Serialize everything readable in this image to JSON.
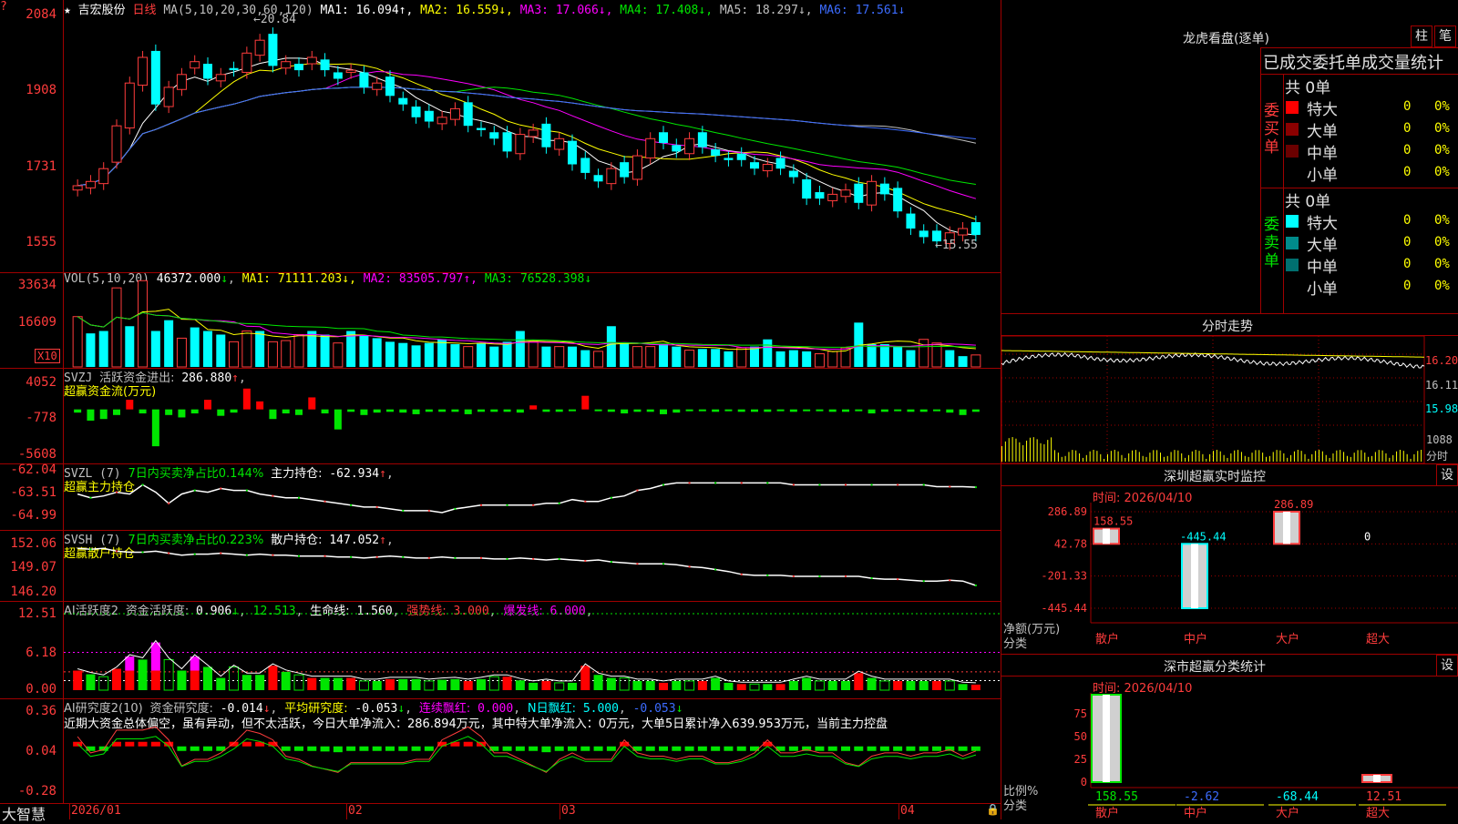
{
  "stock": {
    "name": "吉宏股份",
    "period": "日线",
    "star": "★",
    "leftmark": "?"
  },
  "kline": {
    "ma_label": "MA(5,10,20,30,60,120)",
    "ma": [
      {
        "label": "MA1:",
        "value": "16.094",
        "arrow": "↑",
        "color": "#ffffff"
      },
      {
        "label": "MA2:",
        "value": "16.559",
        "arrow": "↓",
        "color": "#ffff00"
      },
      {
        "label": "MA3:",
        "value": "17.066",
        "arrow": "↓",
        "color": "#ff00ff"
      },
      {
        "label": "MA4:",
        "value": "17.408",
        "arrow": "↓",
        "color": "#00e600"
      },
      {
        "label": "MA5:",
        "value": "18.297",
        "arrow": "↓",
        "color": "#c0c0c0"
      },
      {
        "label": "MA6:",
        "value": "17.561",
        "arrow": "↓",
        "color": "#3c6cff"
      }
    ],
    "yticks": [
      "2084",
      "1908",
      "1731",
      "1555"
    ],
    "high_note": "←20.84",
    "low_note": "←15.55"
  },
  "vol": {
    "title": "VOL(5,10,20)",
    "value": "46372.000",
    "ma": [
      {
        "label": "MA1:",
        "value": "71111.203",
        "arrow": "↓",
        "color": "#ffff00"
      },
      {
        "label": "MA2:",
        "value": "83505.797",
        "arrow": "↑",
        "color": "#ff00ff"
      },
      {
        "label": "MA3:",
        "value": "76528.398",
        "arrow": "↓",
        "color": "#00e600"
      }
    ],
    "yticks": [
      "33634",
      "16609"
    ],
    "unit": "X10"
  },
  "svzj": {
    "title": "SVZJ",
    "label": "活跃资金进出:",
    "value": "286.880",
    "arrow": "↑",
    "subtitle": "超赢资金流(万元)",
    "yticks": [
      "4052",
      "-778",
      "-5608"
    ]
  },
  "svzl": {
    "title": "SVZL (7)",
    "text1": "7日内买卖净占比0.144%",
    "text2": "主力持仓:",
    "value": "-62.934",
    "arrow": "↑",
    "subtitle": "超赢主力持仓",
    "yticks": [
      "-62.04",
      "-63.51",
      "-64.99"
    ]
  },
  "svsh": {
    "title": "SVSH (7)",
    "text1": "7日内买卖净占比0.223%",
    "text2": "散户持仓:",
    "value": "147.052",
    "arrow": "↑",
    "subtitle": "超赢散户持仓",
    "yticks": [
      "152.06",
      "149.07",
      "146.20"
    ]
  },
  "ai1": {
    "title": "AI活跃度2",
    "l1": "资金活跃度:",
    "v1": "0.906",
    "a1": "↓",
    "v2": "12.513",
    "l3": "生命线:",
    "v3": "1.560",
    "l4": "强势线:",
    "v4": "3.000",
    "l5": "爆发线:",
    "v5": "6.000",
    "yticks": [
      "12.51",
      "6.18",
      "0.00"
    ]
  },
  "ai2": {
    "title": "AI研究度2(10)",
    "l1": "资金研究度:",
    "v1": "-0.014",
    "a1": "↓",
    "l2": "平均研究度:",
    "v2": "-0.053",
    "a2": "↓",
    "l3": "连续飘红:",
    "v3": "0.000",
    "l4": "N日飘红:",
    "v4": "5.000",
    "v5": "-0.053",
    "a5": "↓",
    "comment": "近期大资金总体偏空，虽有异动，但不太活跃，今日大单净流入：286.894万元，其中特大单净流入：0万元，大单5日累计净入639.953万元，当前主力控盘",
    "yticks": [
      "0.36",
      "0.04",
      "-0.28"
    ]
  },
  "xaxis": {
    "labels": [
      "2026/01",
      "02",
      "03",
      "04"
    ],
    "brand": "大智慧"
  },
  "right": {
    "lh_title": "龙虎看盘(逐单)",
    "btn_zhu": "柱",
    "btn_bi": "笔",
    "table_title": "已成交委托单成交量统计",
    "buy": {
      "side": "委买单",
      "total": "共 0单",
      "rows": [
        {
          "name": "特大",
          "v": "0",
          "p": "0%",
          "color": "#ff0000"
        },
        {
          "name": "大单",
          "v": "0",
          "p": "0%",
          "color": "#8b0000"
        },
        {
          "name": "中单",
          "v": "0",
          "p": "0%",
          "color": "#6b0000"
        },
        {
          "name": "小单",
          "v": "0",
          "p": "0%",
          "color": ""
        }
      ]
    },
    "sell": {
      "side": "委卖单",
      "total": "共 0单",
      "rows": [
        {
          "name": "特大",
          "v": "0",
          "p": "0%",
          "color": "#00ffff"
        },
        {
          "name": "大单",
          "v": "0",
          "p": "0%",
          "color": "#008b8b"
        },
        {
          "name": "中单",
          "v": "0",
          "p": "0%",
          "color": "#007070"
        },
        {
          "name": "小单",
          "v": "0",
          "p": "0%",
          "color": ""
        }
      ]
    },
    "fs_title": "分时走势",
    "fs_yticks": [
      "16.20",
      "16.11",
      "15.98"
    ],
    "fs_vol": "1088",
    "fs_unit": "分时",
    "mon_title": "深圳超赢实时监控",
    "btn_set": "设",
    "mon_time": "时间: 2026/04/10",
    "mon_yticks": [
      "286.89",
      "42.78",
      "-201.33",
      "-445.44"
    ],
    "mon_ylabel": "净额(万元)",
    "mon_xlabel": "分类",
    "mon_values": [
      "158.55",
      "-445.44",
      "286.89",
      "0"
    ],
    "cats": [
      "散户",
      "中户",
      "大户",
      "超大"
    ],
    "cls_title": "深市超赢分类统计",
    "cls_time": "时间: 2026/04/10",
    "cls_yticks": [
      "75",
      "50",
      "25",
      "0"
    ],
    "cls_ylabel": "比例%",
    "cls_xlabel": "分类",
    "cls_values": [
      "158.55",
      "-2.62",
      "-68.44",
      "12.51"
    ]
  },
  "chart_data": [
    {
      "type": "candlestick",
      "title": "吉宏股份 日线",
      "x": [
        "2026/01",
        "02",
        "03",
        "04"
      ],
      "ylim": [
        15.55,
        20.84
      ],
      "close_approx": [
        17.2,
        17.3,
        17.6,
        18.6,
        19.6,
        20.2,
        19.1,
        19.5,
        19.8,
        20.1,
        19.7,
        19.8,
        19.9,
        20.3,
        20.6,
        20.0,
        20.1,
        19.9,
        20.2,
        19.9,
        19.7,
        19.9,
        19.5,
        19.6,
        19.3,
        19.1,
        18.8,
        18.7,
        18.8,
        19.0,
        18.6,
        18.5,
        18.3,
        18.0,
        18.4,
        18.5,
        18.1,
        18.3,
        17.7,
        17.5,
        17.3,
        17.6,
        17.4,
        17.9,
        18.3,
        18.2,
        18.0,
        18.3,
        18.1,
        17.9,
        17.8,
        17.8,
        17.6,
        17.7,
        17.6,
        17.4,
        16.9,
        16.9,
        17.0,
        17.1,
        16.8,
        17.3,
        17.0,
        16.6,
        16.2,
        16.0,
        15.9,
        16.1,
        16.2,
        16.05
      ],
      "ma_last": [
        16.094,
        16.559,
        17.066,
        17.408,
        18.297,
        17.561
      ]
    },
    {
      "type": "bar",
      "title": "VOL(5,10,20)",
      "ylim": [
        0,
        33634
      ],
      "values_approx": [
        2100,
        1400,
        1500,
        3300,
        1700,
        3600,
        1500,
        1950,
        1200,
        1650,
        1500,
        1350,
        1050,
        1500,
        1500,
        1050,
        1100,
        1350,
        1500,
        1350,
        1000,
        1500,
        1300,
        1200,
        1050,
        1000,
        900,
        1000,
        1150,
        950,
        850,
        1000,
        850,
        1050,
        1500,
        1050,
        850,
        850,
        850,
        700,
        650,
        1700,
        1000,
        850,
        850,
        950,
        850,
        700,
        750,
        750,
        650,
        800,
        850,
        1150,
        650,
        700,
        650,
        550,
        650,
        800,
        1850,
        950,
        950,
        850,
        700,
        1150,
        1000,
        700,
        450,
        500
      ],
      "up_flags": [
        1,
        0,
        0,
        1,
        0,
        1,
        0,
        0,
        1,
        0,
        0,
        0,
        1,
        1,
        0,
        1,
        1,
        1,
        0,
        0,
        1,
        0,
        0,
        0,
        0,
        0,
        0,
        0,
        0,
        0,
        1,
        0,
        0,
        0,
        0,
        1,
        0,
        1,
        0,
        0,
        1,
        0,
        0,
        1,
        1,
        0,
        0,
        1,
        0,
        0,
        0,
        1,
        0,
        0,
        0,
        0,
        0,
        1,
        1,
        1,
        0,
        0,
        0,
        0,
        0,
        1,
        1,
        0,
        0,
        1
      ]
    },
    {
      "type": "bar",
      "title": "SVZJ 超赢资金流(万元)",
      "ylim": [
        -5608,
        4052
      ],
      "values_approx": [
        -400,
        -1400,
        -1200,
        -700,
        1200,
        -500,
        -4600,
        -700,
        -1000,
        -500,
        1200,
        -800,
        -400,
        2600,
        1000,
        -1200,
        -500,
        -700,
        1500,
        -500,
        -2500,
        -300,
        -700,
        -400,
        -300,
        -400,
        -600,
        -300,
        -300,
        -300,
        -600,
        -300,
        -300,
        -300,
        -400,
        500,
        -300,
        -300,
        -200,
        1700,
        -200,
        -300,
        -500,
        -300,
        -300,
        -600,
        -400,
        -200,
        -200,
        -300,
        -200,
        -300,
        -300,
        -300,
        -200,
        -300,
        -200,
        -200,
        -300,
        -300,
        -200,
        -500,
        -300,
        -200,
        -300,
        -300,
        -200,
        -400,
        -700,
        -300
      ]
    },
    {
      "type": "line",
      "title": "SVZL 主力持仓",
      "ylim": [
        -64.99,
        -62.04
      ],
      "values_approx": [
        -63.3,
        -63.5,
        -63.4,
        -63.2,
        -63.3,
        -62.8,
        -63.2,
        -63.8,
        -63.3,
        -63.1,
        -63.2,
        -63.0,
        -63.1,
        -63.1,
        -63.3,
        -63.4,
        -63.5,
        -63.5,
        -63.6,
        -63.7,
        -63.8,
        -63.9,
        -64.0,
        -64.0,
        -64.1,
        -64.2,
        -64.2,
        -64.2,
        -64.3,
        -64.1,
        -64.0,
        -63.9,
        -63.9,
        -63.9,
        -63.9,
        -63.9,
        -63.8,
        -63.8,
        -63.6,
        -63.7,
        -63.7,
        -63.5,
        -63.4,
        -63.1,
        -63.0,
        -62.8,
        -62.7,
        -62.7,
        -62.7,
        -62.7,
        -62.7,
        -62.7,
        -62.7,
        -62.7,
        -62.7,
        -62.8,
        -62.8,
        -62.8,
        -62.8,
        -62.8,
        -62.8,
        -62.8,
        -62.8,
        -62.8,
        -62.8,
        -62.8,
        -62.9,
        -62.9,
        -62.9,
        -62.93
      ]
    },
    {
      "type": "line",
      "title": "SVSH 散户持仓",
      "ylim": [
        146.2,
        152.06
      ],
      "values_approx": [
        150.9,
        150.8,
        150.9,
        150.6,
        150.5,
        150.5,
        150.6,
        150.4,
        150.2,
        150.3,
        150.3,
        150.4,
        150.3,
        150.2,
        150.3,
        150.2,
        150.2,
        150.1,
        150.1,
        150.1,
        150.0,
        150.0,
        149.9,
        150.0,
        150.1,
        150.0,
        149.9,
        149.9,
        150.0,
        149.9,
        149.9,
        149.9,
        149.8,
        149.8,
        149.9,
        149.8,
        149.7,
        149.8,
        149.7,
        149.6,
        149.7,
        149.5,
        149.4,
        149.3,
        149.3,
        149.3,
        149.2,
        149.0,
        148.9,
        148.7,
        148.5,
        148.2,
        148.1,
        148.1,
        148.1,
        148.0,
        148.0,
        148.0,
        148.0,
        148.0,
        148.0,
        147.8,
        147.7,
        147.7,
        147.6,
        147.5,
        147.5,
        147.6,
        147.5,
        147.05
      ]
    },
    {
      "type": "bar",
      "title": "AI活跃度2",
      "ylim": [
        0,
        12.51
      ],
      "values_approx": [
        3.2,
        2.6,
        2.2,
        3.5,
        5.5,
        5.0,
        7.8,
        5.0,
        3.2,
        5.5,
        3.8,
        2.0,
        3.8,
        2.5,
        2.5,
        4.0,
        3.0,
        2.5,
        2.0,
        2.0,
        2.0,
        2.0,
        1.5,
        1.5,
        1.8,
        1.8,
        1.8,
        1.5,
        1.7,
        1.8,
        1.5,
        1.8,
        2.2,
        2.2,
        1.6,
        1.2,
        1.5,
        1.2,
        1.2,
        4.0,
        2.5,
        2.0,
        2.0,
        1.5,
        1.5,
        1.2,
        1.5,
        1.5,
        1.5,
        2.0,
        1.2,
        1.0,
        1.0,
        1.0,
        1.0,
        1.5,
        2.0,
        1.5,
        1.5,
        1.5,
        2.8,
        2.0,
        1.5,
        1.5,
        1.5,
        1.5,
        1.5,
        1.5,
        1.0,
        0.906
      ]
    },
    {
      "type": "bar",
      "title": "AI研究度2(10)",
      "ylim": [
        -0.28,
        0.36
      ],
      "values_approx": [
        0.03,
        -0.02,
        -0.01,
        0.05,
        0.05,
        0.05,
        0.06,
        0.02,
        -0.06,
        -0.04,
        -0.04,
        -0.02,
        0.01,
        0.05,
        0.04,
        0.02,
        -0.03,
        -0.04,
        -0.06,
        -0.07,
        -0.08,
        -0.05,
        -0.05,
        -0.05,
        -0.05,
        -0.05,
        -0.04,
        -0.04,
        0.02,
        0.04,
        0.06,
        0.03,
        -0.02,
        -0.02,
        -0.04,
        -0.06,
        -0.08,
        -0.04,
        -0.02,
        -0.04,
        -0.04,
        -0.04,
        0.02,
        -0.02,
        -0.03,
        -0.03,
        -0.04,
        -0.03,
        -0.03,
        -0.05,
        -0.05,
        -0.04,
        -0.02,
        0.02,
        -0.02,
        -0.02,
        -0.01,
        -0.02,
        -0.02,
        -0.05,
        -0.06,
        -0.03,
        -0.02,
        -0.02,
        -0.03,
        -0.02,
        -0.02,
        -0.01,
        -0.03,
        -0.014
      ]
    },
    {
      "type": "bar",
      "title": "深圳超赢实时监控",
      "categories": [
        "散户",
        "中户",
        "大户",
        "超大"
      ],
      "values": [
        158.55,
        -445.44,
        286.89,
        0
      ],
      "ylabel": "净额(万元)"
    },
    {
      "type": "bar",
      "title": "深市超赢分类统计",
      "categories": [
        "散户",
        "中户",
        "大户",
        "超大"
      ],
      "values": [
        158.55,
        -2.62,
        -68.44,
        12.51
      ],
      "ylabel": "比例%",
      "ylim": [
        0,
        75
      ]
    }
  ]
}
